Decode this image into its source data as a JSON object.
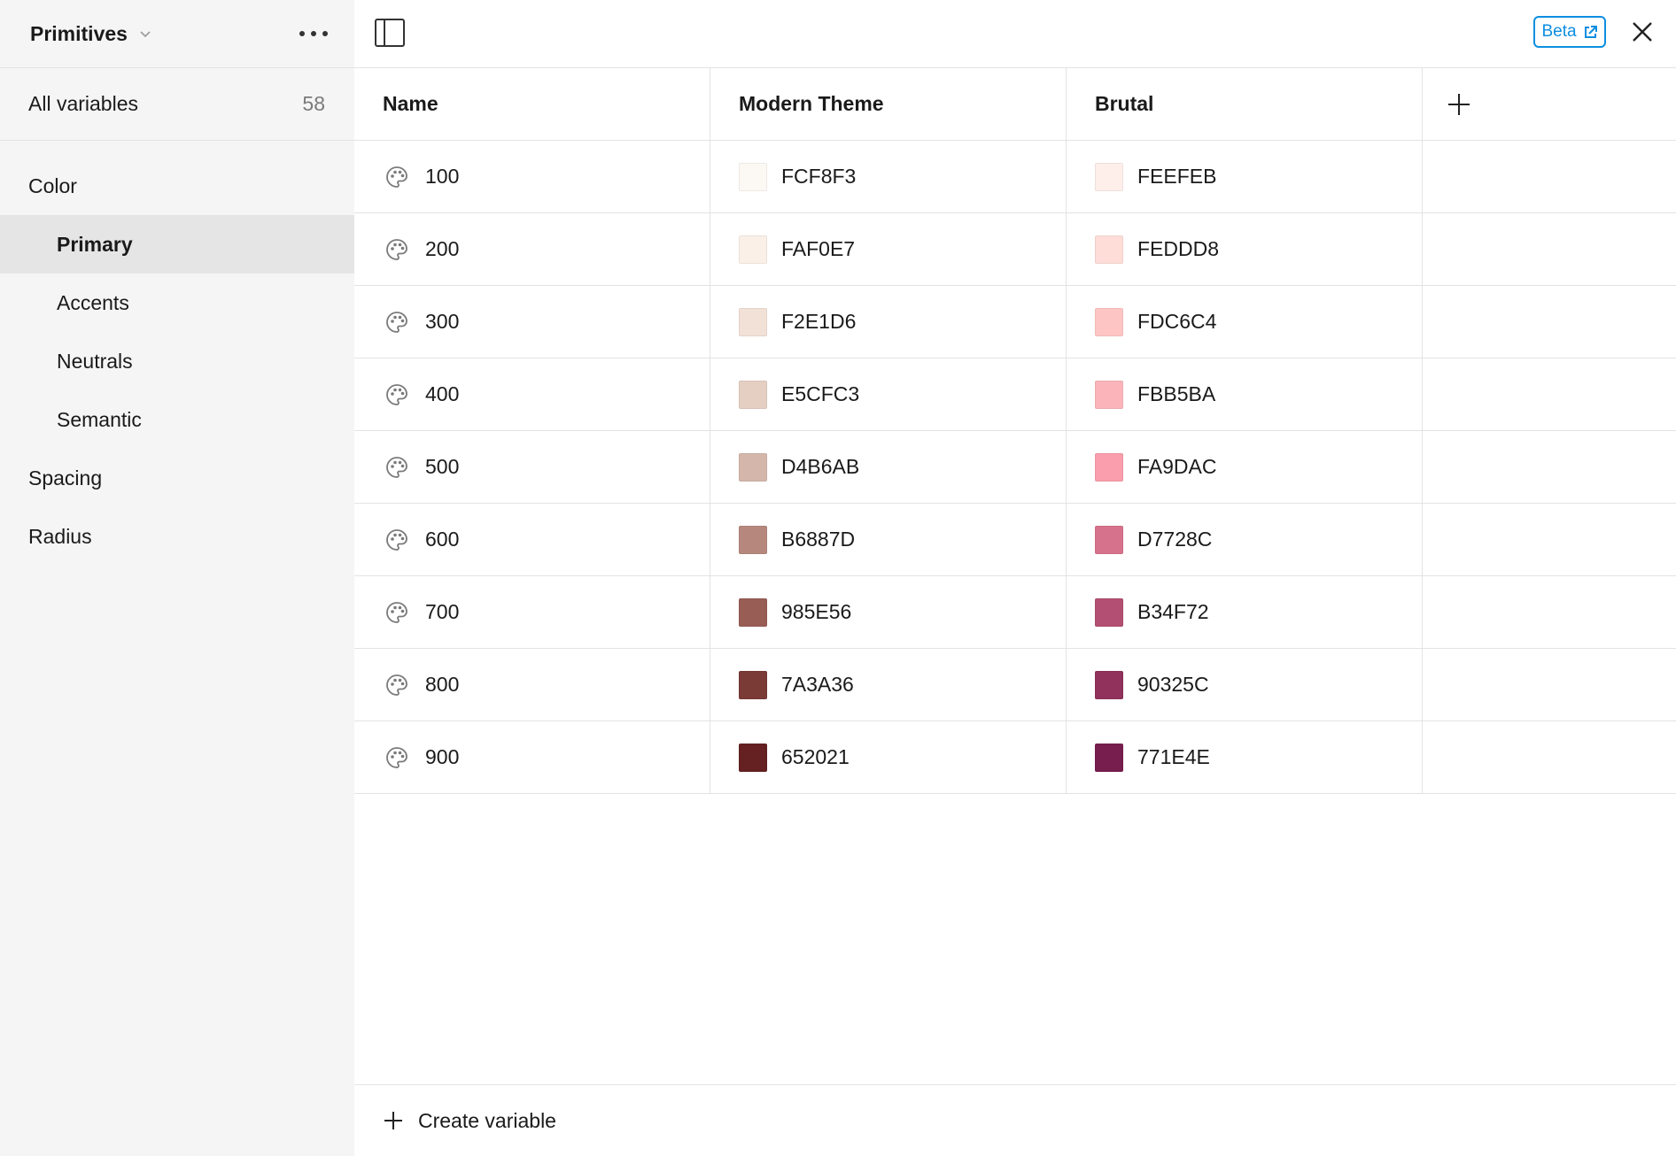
{
  "sidebar": {
    "collection_name": "Primitives",
    "all_variables_label": "All variables",
    "all_variables_count": "58",
    "groups": [
      {
        "label": "Color"
      },
      {
        "label": "Primary"
      },
      {
        "label": "Accents"
      },
      {
        "label": "Neutrals"
      },
      {
        "label": "Semantic"
      },
      {
        "label": "Spacing"
      },
      {
        "label": "Radius"
      }
    ]
  },
  "topbar": {
    "beta_label": "Beta"
  },
  "table": {
    "headers": [
      "Name",
      "Modern Theme",
      "Brutal"
    ],
    "rows": [
      {
        "name": "100",
        "modern": "FCF8F3",
        "brutal": "FEEFEB"
      },
      {
        "name": "200",
        "modern": "FAF0E7",
        "brutal": "FEDDD8"
      },
      {
        "name": "300",
        "modern": "F2E1D6",
        "brutal": "FDC6C4"
      },
      {
        "name": "400",
        "modern": "E5CFC3",
        "brutal": "FBB5BA"
      },
      {
        "name": "500",
        "modern": "D4B6AB",
        "brutal": "FA9DAC"
      },
      {
        "name": "600",
        "modern": "B6887D",
        "brutal": "D7728C"
      },
      {
        "name": "700",
        "modern": "985E56",
        "brutal": "B34F72"
      },
      {
        "name": "800",
        "modern": "7A3A36",
        "brutal": "90325C"
      },
      {
        "name": "900",
        "modern": "652021",
        "brutal": "771E4E"
      }
    ]
  },
  "footer": {
    "create_label": "Create variable"
  },
  "icons": [
    "chevron-down-icon",
    "more-icon",
    "sidebar-toggle-icon",
    "external-link-icon",
    "close-icon",
    "plus-icon",
    "palette-icon"
  ],
  "colors": {
    "accent": "#0d8ee0",
    "sidebar_bg": "#f5f5f5",
    "active_item_bg": "#e5e5e5",
    "border": "#e3e3e3"
  }
}
